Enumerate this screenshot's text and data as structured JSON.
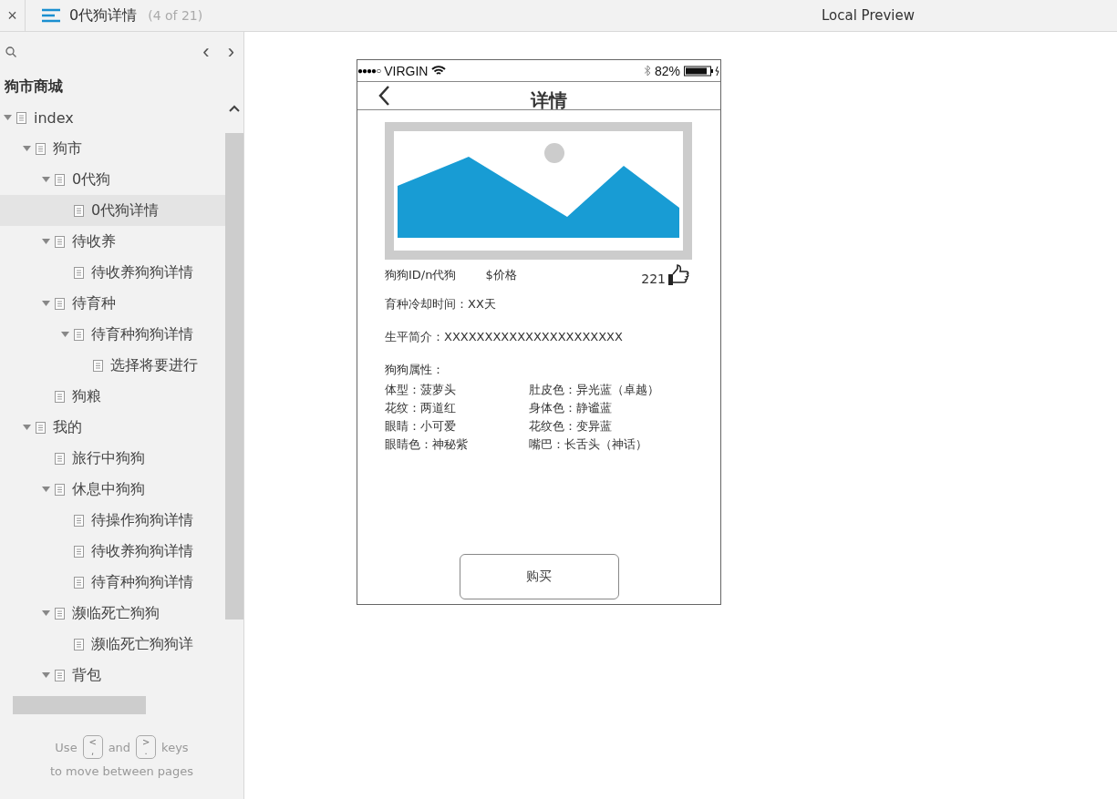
{
  "topbar": {
    "close": "×",
    "page_title": "0代狗详情",
    "page_count": "(4 of 21)",
    "preview_title": "Local Preview"
  },
  "sidebar": {
    "nav_prev": "‹",
    "nav_next": "›",
    "project_title": "狗市商城",
    "tree": [
      {
        "label": "index",
        "expanded": true,
        "selected": false,
        "children": [
          {
            "label": "狗市",
            "expanded": true,
            "selected": false,
            "children": [
              {
                "label": "0代狗",
                "expanded": true,
                "selected": false,
                "children": [
                  {
                    "label": "0代狗详情",
                    "selected": true
                  }
                ]
              },
              {
                "label": "待收养",
                "expanded": true,
                "selected": false,
                "children": [
                  {
                    "label": "待收养狗狗详情",
                    "selected": false
                  }
                ]
              },
              {
                "label": "待育种",
                "expanded": true,
                "selected": false,
                "children": [
                  {
                    "label": "待育种狗狗详情",
                    "expanded": true,
                    "selected": false,
                    "children": [
                      {
                        "label": "选择将要进行",
                        "selected": false
                      }
                    ]
                  }
                ]
              },
              {
                "label": "狗粮",
                "selected": false
              }
            ]
          },
          {
            "label": "我的",
            "expanded": true,
            "selected": false,
            "children": [
              {
                "label": "旅行中狗狗",
                "selected": false
              },
              {
                "label": "休息中狗狗",
                "expanded": true,
                "selected": false,
                "children": [
                  {
                    "label": "待操作狗狗详情",
                    "selected": false
                  },
                  {
                    "label": "待收养狗狗详情",
                    "selected": false
                  },
                  {
                    "label": "待育种狗狗详情",
                    "selected": false
                  }
                ]
              },
              {
                "label": "濒临死亡狗狗",
                "expanded": true,
                "selected": false,
                "children": [
                  {
                    "label": "濒临死亡狗狗详",
                    "selected": false
                  }
                ]
              },
              {
                "label": "背包",
                "expanded": true,
                "selected": false
              }
            ]
          }
        ]
      }
    ],
    "help": {
      "use": "Use",
      "key1_top": "<",
      "key1_bottom": ",",
      "and": "and",
      "key2_top": ">",
      "key2_bottom": ".",
      "keys": "keys",
      "line2": "to move between pages"
    }
  },
  "phone": {
    "status": {
      "signal": "●●●●○",
      "carrier": "VIRGIN",
      "battery": "82%"
    },
    "nav": {
      "title": "详情"
    },
    "info": {
      "id": "狗狗ID/n代狗",
      "price": "$价格",
      "likes": "221"
    },
    "cooldown": "育种冷却时间：XX天",
    "bio": "生平简介：XXXXXXXXXXXXXXXXXXXXXX",
    "attrs_title": "狗狗属性：",
    "attrs": [
      [
        "体型：菠萝头",
        " 肚皮色：异光蓝（卓越）"
      ],
      [
        "花纹：两道红",
        "身体色：静谧蓝"
      ],
      [
        "眼睛：小可爱",
        "花纹色：变异蓝"
      ],
      [
        "眼睛色：神秘紫",
        "嘴巴：长舌头（神话）"
      ]
    ],
    "buy": "购买"
  }
}
